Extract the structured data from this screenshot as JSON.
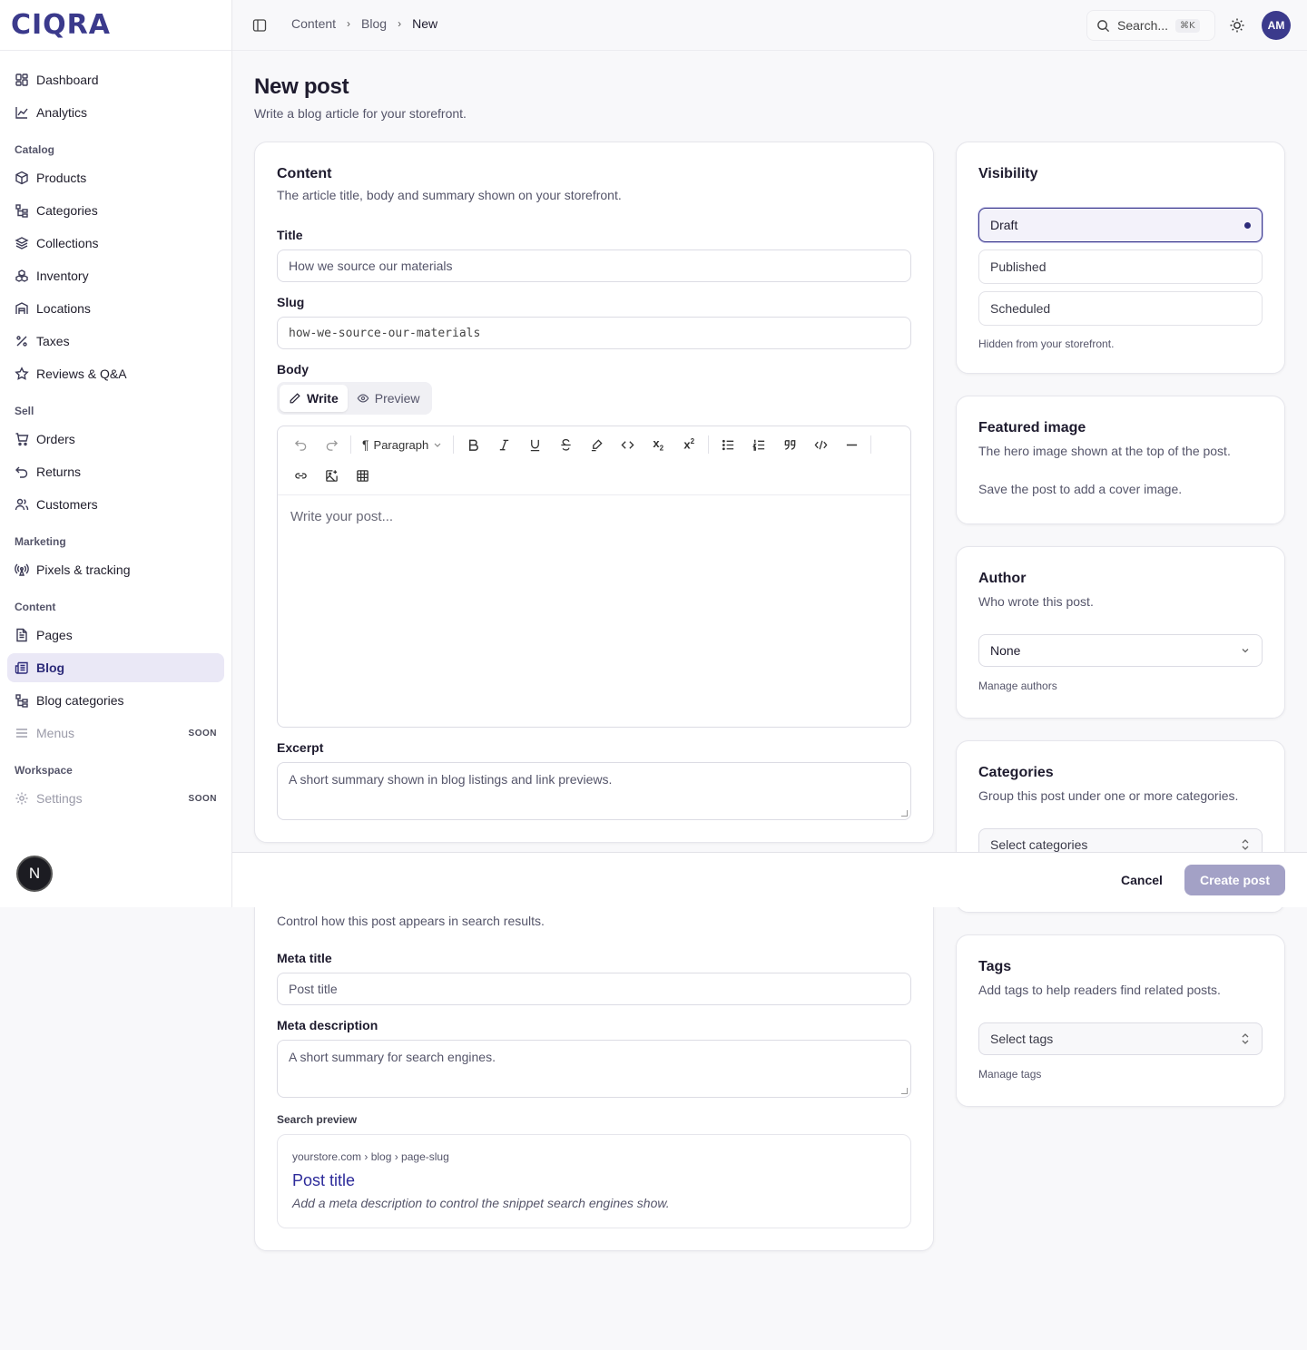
{
  "brand": {
    "logo_text": "CIQRA"
  },
  "sidebar": {
    "top_items": [
      {
        "label": "Dashboard",
        "icon": "dashboard-icon"
      },
      {
        "label": "Analytics",
        "icon": "chart-line-icon"
      }
    ],
    "groups": [
      {
        "title": "Catalog",
        "items": [
          "Products",
          "Categories",
          "Collections",
          "Inventory",
          "Locations",
          "Taxes",
          "Reviews & Q&A"
        ]
      },
      {
        "title": "Sell",
        "items": [
          "Orders",
          "Returns",
          "Customers"
        ]
      },
      {
        "title": "Marketing",
        "items": [
          "Pixels & tracking"
        ]
      },
      {
        "title": "Content",
        "items": [
          "Pages",
          "Blog",
          "Blog categories",
          "Menus"
        ]
      },
      {
        "title": "Workspace",
        "items": [
          "Settings"
        ]
      }
    ],
    "active_item": "Blog",
    "soon_badge": "SOON",
    "bubble_letter": "N"
  },
  "topbar": {
    "breadcrumbs": [
      "Content",
      "Blog",
      "New"
    ],
    "search_placeholder": "Search...",
    "search_shortcut": "⌘K",
    "avatar_initials": "AM"
  },
  "page": {
    "title": "New post",
    "subtitle": "Write a blog article for your storefront."
  },
  "content_card": {
    "title": "Content",
    "description": "The article title, body and summary shown on your storefront.",
    "title_label": "Title",
    "title_value": "How we source our materials",
    "slug_label": "Slug",
    "slug_value": "how-we-source-our-materials",
    "body_label": "Body",
    "tab_write": "Write",
    "tab_preview": "Preview",
    "paragraph_select": "Paragraph",
    "body_placeholder": "Write your post...",
    "excerpt_label": "Excerpt",
    "excerpt_placeholder": "A short summary shown in blog listings and link previews."
  },
  "seo_card": {
    "description": "Control how this post appears in search results.",
    "meta_title_label": "Meta title",
    "meta_title_placeholder": "Post title",
    "meta_desc_label": "Meta description",
    "meta_desc_placeholder": "A short summary for search engines.",
    "search_preview_label": "Search preview",
    "preview_url": "yourstore.com › blog › page-slug",
    "preview_title": "Post title",
    "preview_desc": "Add a meta description to control the snippet search engines show."
  },
  "visibility_card": {
    "title": "Visibility",
    "options": [
      "Draft",
      "Published",
      "Scheduled"
    ],
    "selected": "Draft",
    "hint": "Hidden from your storefront."
  },
  "featured_card": {
    "title": "Featured image",
    "description": "The hero image shown at the top of the post.",
    "note": "Save the post to add a cover image."
  },
  "author_card": {
    "title": "Author",
    "description": "Who wrote this post.",
    "selected": "None",
    "manage_link": "Manage authors"
  },
  "categories_card": {
    "title": "Categories",
    "description": "Group this post under one or more categories.",
    "placeholder": "Select categories"
  },
  "tags_card": {
    "title": "Tags",
    "description": "Add tags to help readers find related posts.",
    "placeholder": "Select tags",
    "manage_link": "Manage tags"
  },
  "footer": {
    "cancel_label": "Cancel",
    "create_label": "Create post"
  },
  "colors": {
    "accent": "#3b3a8c",
    "active_bg": "#eae8f6",
    "create_disabled": "#a3a1c6"
  }
}
